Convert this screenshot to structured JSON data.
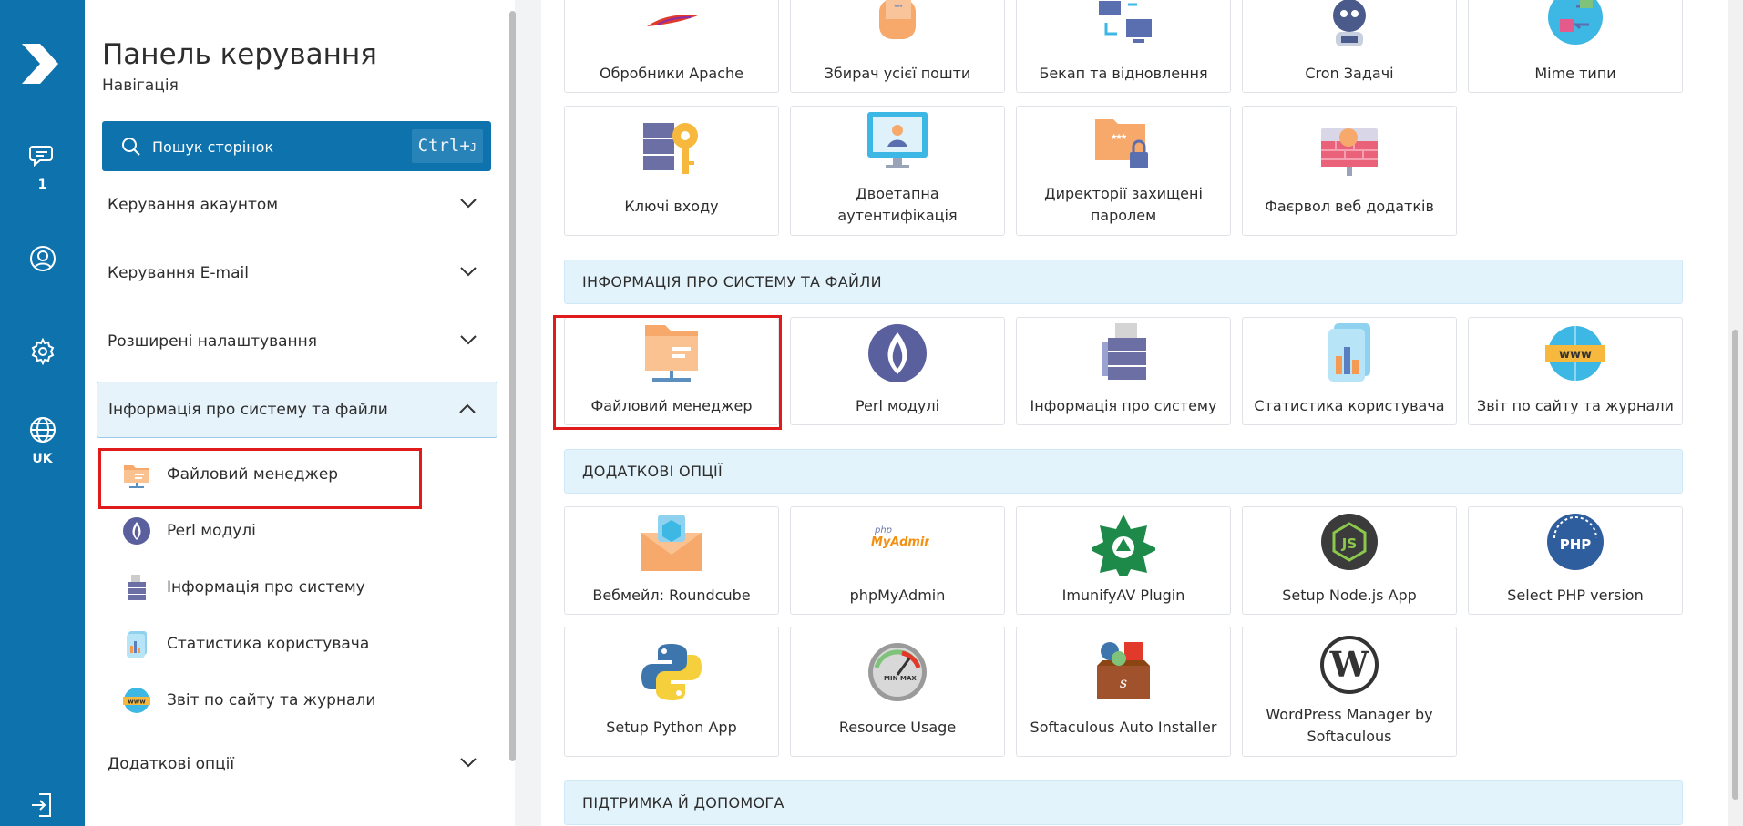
{
  "rail": {
    "chat_count": "1",
    "lang_label": "UK"
  },
  "sidebar": {
    "title": "Панель керування",
    "subtitle": "Навігація",
    "search_placeholder": "Пошук сторінок",
    "search_shortcut": "Ctrl+",
    "search_shortcut_key": "J",
    "sections": [
      {
        "label": "Керування акаунтом",
        "expanded": false
      },
      {
        "label": "Керування E-mail",
        "expanded": false
      },
      {
        "label": "Розширені налаштування",
        "expanded": false
      },
      {
        "label": "Інформація про систему та файли",
        "expanded": true
      },
      {
        "label": "Додаткові опції",
        "expanded": false
      }
    ],
    "sub_items": [
      {
        "label": "Файловий менеджер",
        "icon": "folder-icon",
        "highlighted": true
      },
      {
        "label": "Perl модулі",
        "icon": "perl-onion-icon"
      },
      {
        "label": "Інформація про систему",
        "icon": "server-icon"
      },
      {
        "label": "Статистика користувача",
        "icon": "stats-icon"
      },
      {
        "label": "Звіт по сайту та журнали",
        "icon": "www-globe-icon"
      }
    ]
  },
  "main": {
    "row1": [
      {
        "label": "Обробники Apache",
        "icon": "apache-feather-icon"
      },
      {
        "label": "Збирач усієї пошти",
        "icon": "catch-all-hand-icon"
      },
      {
        "label": "Бекап та відновлення",
        "icon": "backup-computers-icon"
      },
      {
        "label": "Cron Задачі",
        "icon": "robot-icon"
      },
      {
        "label": "Mime типи",
        "icon": "mime-globe-icon"
      }
    ],
    "row2": [
      {
        "label": "Ключі входу",
        "icon": "ssh-key-icon"
      },
      {
        "label": "Двоетапна аутентифікація",
        "icon": "two-factor-icon"
      },
      {
        "label": "Директорії захищені паролем",
        "icon": "locked-folder-icon"
      },
      {
        "label": "Фаєрвол веб додатків",
        "icon": "firewall-icon"
      }
    ],
    "group_system": "ІНФОРМАЦІЯ ПРО СИСТЕМУ ТА ФАЙЛИ",
    "row3": [
      {
        "label": "Файловий менеджер",
        "icon": "folder-icon",
        "highlighted": true
      },
      {
        "label": "Perl модулі",
        "icon": "perl-onion-icon"
      },
      {
        "label": "Інформація про систему",
        "icon": "server-icon"
      },
      {
        "label": "Статистика користувача",
        "icon": "stats-icon"
      },
      {
        "label": "Звіт по сайту та журнали",
        "icon": "www-globe-icon"
      }
    ],
    "group_extra": "ДОДАТКОВІ ОПЦІЇ",
    "row4": [
      {
        "label": "Вебмейл: Roundcube",
        "icon": "roundcube-icon"
      },
      {
        "label": "phpMyAdmin",
        "icon": "phpmyadmin-icon",
        "logo_top": "php",
        "logo_bottom": "MyAdmin"
      },
      {
        "label": "ImunifyAV Plugin",
        "icon": "imunify-icon"
      },
      {
        "label": "Setup Node.js App",
        "icon": "nodejs-icon",
        "logo_text": "JS"
      },
      {
        "label": "Select PHP version",
        "icon": "php-gauge-icon",
        "logo_text": "PHP"
      }
    ],
    "row5": [
      {
        "label": "Setup Python App",
        "icon": "python-icon"
      },
      {
        "label": "Resource Usage",
        "icon": "speedometer-icon",
        "gauge_min": "MIN",
        "gauge_max": "MAX"
      },
      {
        "label": "Softaculous Auto Installer",
        "icon": "softaculous-icon"
      },
      {
        "label": "WordPress Manager by Softaculous",
        "icon": "wordpress-icon"
      }
    ],
    "group_support": "ПІДТРИМКА Й ДОПОМОГА"
  },
  "colors": {
    "rail_blue": "#0e72ad",
    "group_bg": "#e3f3fb",
    "highlight_red": "#e01b1b",
    "folder_orange": "#f6a96a"
  }
}
